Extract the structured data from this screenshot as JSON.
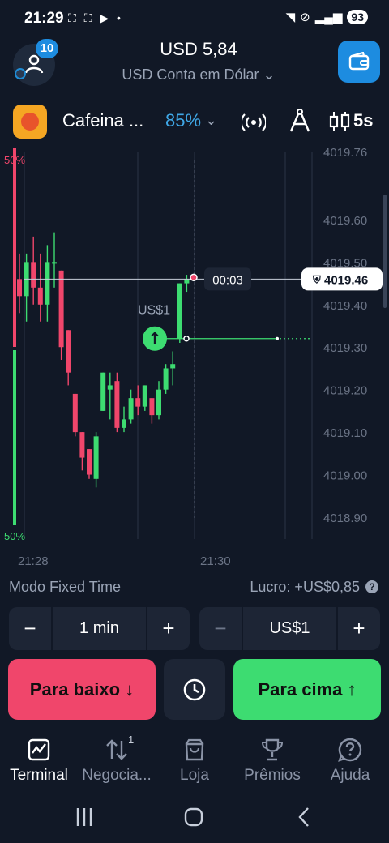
{
  "status_bar": {
    "time": "21:29",
    "battery": "93"
  },
  "header": {
    "notifications": "10",
    "balance": "USD 5,84",
    "account": "USD Conta em Dólar"
  },
  "asset": {
    "name": "Cafeina ...",
    "payout": "85%",
    "timeframe": "5s"
  },
  "chart": {
    "pct_top": "50%",
    "pct_bottom": "50%",
    "price_labels": [
      "4019.76",
      "4019.60",
      "4019.50",
      "4019.40",
      "4019.30",
      "4019.20",
      "4019.10",
      "4019.00",
      "4018.90"
    ],
    "time_labels": [
      "21:28",
      "21:30"
    ],
    "current_price": "4019.46",
    "countdown": "00:03",
    "trade_amount": "US$1",
    "colors": {
      "up": "#3ddc71",
      "down": "#f0466b",
      "grid": "#2a3345"
    }
  },
  "chart_data": {
    "type": "candlestick",
    "ylim": [
      4018.86,
      4019.78
    ],
    "candles": [
      {
        "o": 4019.46,
        "h": 4019.52,
        "l": 4019.38,
        "c": 4019.42
      },
      {
        "o": 4019.42,
        "h": 4019.52,
        "l": 4019.36,
        "c": 4019.5
      },
      {
        "o": 4019.5,
        "h": 4019.56,
        "l": 4019.4,
        "c": 4019.44
      },
      {
        "o": 4019.44,
        "h": 4019.52,
        "l": 4019.36,
        "c": 4019.4
      },
      {
        "o": 4019.4,
        "h": 4019.54,
        "l": 4019.36,
        "c": 4019.5
      },
      {
        "o": 4019.5,
        "h": 4019.57,
        "l": 4019.44,
        "c": 4019.5
      },
      {
        "o": 4019.48,
        "h": 4019.48,
        "l": 4019.27,
        "c": 4019.3
      },
      {
        "o": 4019.34,
        "h": 4019.34,
        "l": 4019.21,
        "c": 4019.24
      },
      {
        "o": 4019.19,
        "h": 4019.19,
        "l": 4019.09,
        "c": 4019.1
      },
      {
        "o": 4019.1,
        "h": 4019.1,
        "l": 4019.01,
        "c": 4019.04
      },
      {
        "o": 4019.06,
        "h": 4019.06,
        "l": 4018.99,
        "c": 4019.0
      },
      {
        "o": 4018.99,
        "h": 4019.1,
        "l": 4018.97,
        "c": 4019.09
      },
      {
        "o": 4019.15,
        "h": 4019.24,
        "l": 4019.15,
        "c": 4019.24
      },
      {
        "o": 4019.2,
        "h": 4019.24,
        "l": 4019.13,
        "c": 4019.21
      },
      {
        "o": 4019.22,
        "h": 4019.24,
        "l": 4019.1,
        "c": 4019.11
      },
      {
        "o": 4019.11,
        "h": 4019.16,
        "l": 4019.1,
        "c": 4019.13
      },
      {
        "o": 4019.13,
        "h": 4019.2,
        "l": 4019.12,
        "c": 4019.18
      },
      {
        "o": 4019.18,
        "h": 4019.21,
        "l": 4019.14,
        "c": 4019.16
      },
      {
        "o": 4019.16,
        "h": 4019.21,
        "l": 4019.15,
        "c": 4019.21
      },
      {
        "o": 4019.18,
        "h": 4019.18,
        "l": 4019.12,
        "c": 4019.14
      },
      {
        "o": 4019.14,
        "h": 4019.22,
        "l": 4019.13,
        "c": 4019.2
      },
      {
        "o": 4019.2,
        "h": 4019.26,
        "l": 4019.19,
        "c": 4019.25
      },
      {
        "o": 4019.25,
        "h": 4019.29,
        "l": 4019.21,
        "c": 4019.26
      },
      {
        "o": 4019.32,
        "h": 4019.45,
        "l": 4019.31,
        "c": 4019.45
      },
      {
        "o": 4019.45,
        "h": 4019.47,
        "l": 4019.43,
        "c": 4019.46
      }
    ]
  },
  "controls": {
    "mode": "Modo Fixed Time",
    "profit": "Lucro: +US$0,85",
    "time_value": "1 min",
    "amount_value": "US$1",
    "minus": "−",
    "plus": "+",
    "down_label": "Para baixo ↓",
    "up_label": "Para cima ↑"
  },
  "nav": {
    "items": [
      {
        "label": "Terminal",
        "icon": "chart-icon"
      },
      {
        "label": "Negocia...",
        "icon": "trades-icon",
        "badge": "1"
      },
      {
        "label": "Loja",
        "icon": "shop-icon"
      },
      {
        "label": "Prêmios",
        "icon": "trophy-icon"
      },
      {
        "label": "Ajuda",
        "icon": "help-icon"
      }
    ]
  }
}
